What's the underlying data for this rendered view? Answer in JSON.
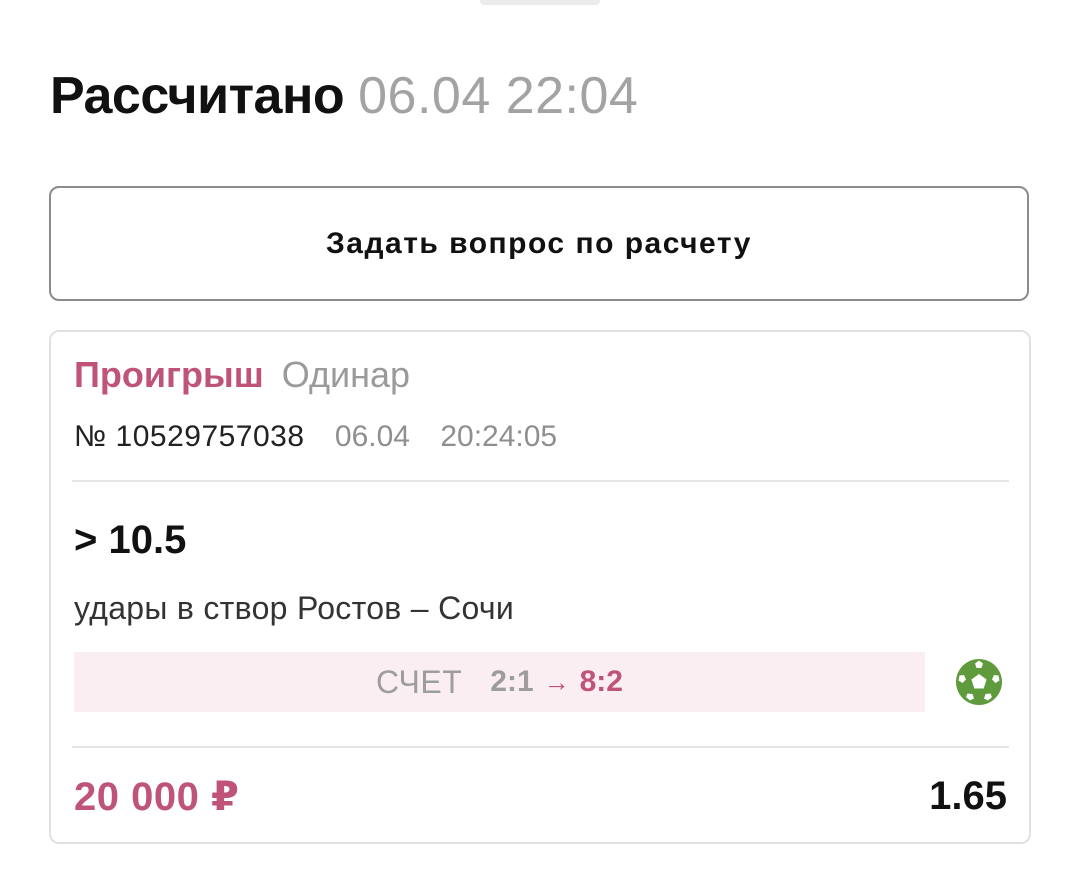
{
  "header": {
    "title": "Рассчитано",
    "settled_at": "06.04 22:04"
  },
  "ask_button": {
    "label": "Задать вопрос по расчету"
  },
  "bet": {
    "result": "Проигрыш",
    "type": "Одинар",
    "number": "№ 10529757038",
    "date": "06.04",
    "time": "20:24:05",
    "outcome": "> 10.5",
    "market": "удары в створ Ростов – Сочи",
    "score": {
      "label": "СЧЕТ",
      "initial": "2:1",
      "arrow": "→",
      "final": "8:2"
    },
    "sport_icon": "soccer-ball-icon",
    "stake": "20 000 ₽",
    "odds": "1.65"
  },
  "colors": {
    "loss_accent": "#bf5478",
    "score_background": "#fbeef2",
    "sport_icon_green": "#5f9a3c",
    "muted_text": "#9a9a9a"
  }
}
